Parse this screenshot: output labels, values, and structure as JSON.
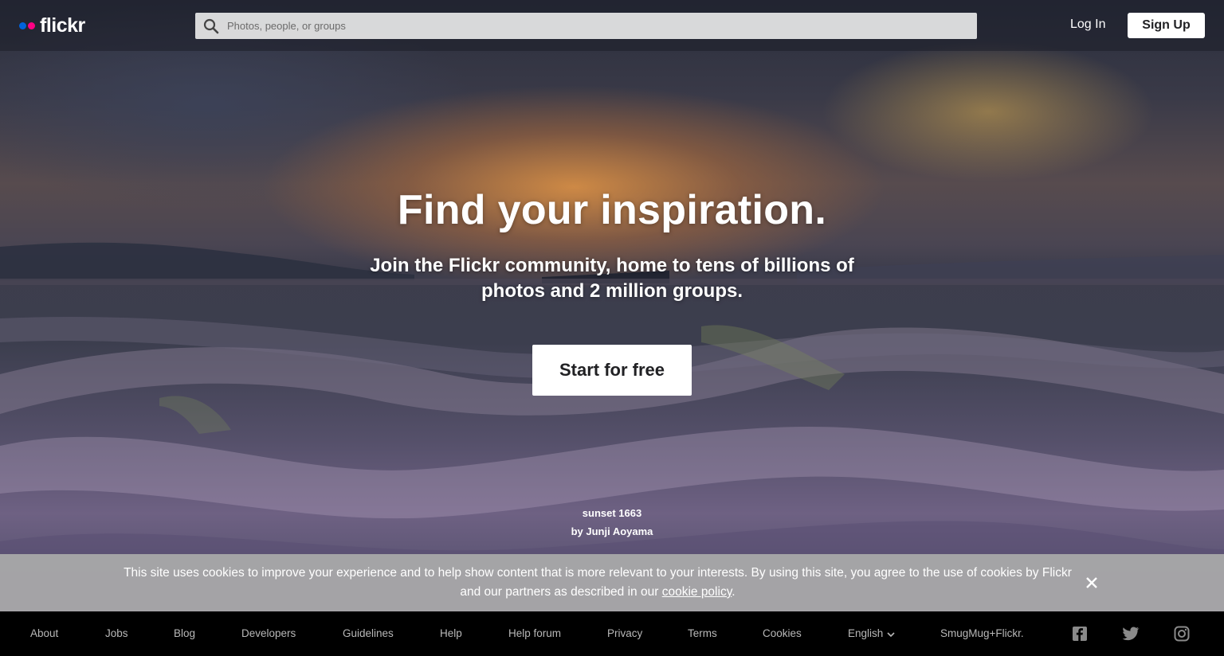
{
  "header": {
    "logo_text": "flickr",
    "search_placeholder": "Photos, people, or groups",
    "login_label": "Log In",
    "signup_label": "Sign Up"
  },
  "hero": {
    "title": "Find your inspiration.",
    "subtitle": "Join the Flickr community, home to tens of billions of photos and 2 million groups.",
    "cta_label": "Start for free",
    "photo_title": "sunset 1663",
    "photo_credit": "by Junji Aoyama"
  },
  "cookie_banner": {
    "text_before": "This site uses cookies to improve your experience and to help show content that is more relevant to your interests. By using this site, you agree to the use of cookies by Flickr and our partners as described in our ",
    "link_text": "cookie policy",
    "text_after": "."
  },
  "footer": {
    "links": [
      "About",
      "Jobs",
      "Blog",
      "Developers",
      "Guidelines",
      "Help",
      "Help forum",
      "Privacy",
      "Terms",
      "Cookies"
    ],
    "language": "English",
    "brand_link": "SmugMug+Flickr.",
    "social_icons": [
      "facebook-icon",
      "twitter-icon",
      "instagram-icon"
    ]
  },
  "colors": {
    "logo_blue": "#0063dc",
    "logo_pink": "#ff0084",
    "footer_bg": "#000000",
    "cookie_bg": "#aaaaaa"
  }
}
